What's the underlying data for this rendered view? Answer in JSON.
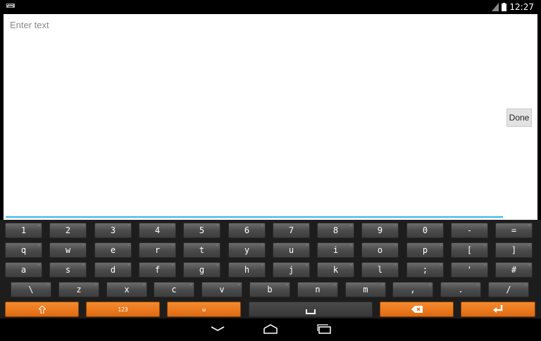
{
  "status_bar": {
    "time": "12:27"
  },
  "editor": {
    "placeholder": "Enter text",
    "done_label": "Done"
  },
  "keyboard": {
    "rows": [
      [
        "1",
        "2",
        "3",
        "4",
        "5",
        "6",
        "7",
        "8",
        "9",
        "0",
        "-",
        "="
      ],
      [
        "q",
        "w",
        "e",
        "r",
        "t",
        "y",
        "u",
        "i",
        "o",
        "p",
        "[",
        "]"
      ],
      [
        "a",
        "s",
        "d",
        "f",
        "g",
        "h",
        "j",
        "k",
        "l",
        ";",
        "'",
        "#"
      ],
      [
        "\\",
        "z",
        "x",
        "c",
        "v",
        "b",
        "n",
        "m",
        ",",
        ".",
        "/"
      ]
    ],
    "function_row": {
      "numbers_label": "123",
      "layout_label": "ω"
    }
  },
  "icons": {
    "notification": "keyboard-notification-icon",
    "signal": "signal-icon",
    "battery": "battery-icon",
    "shift": "shift-icon",
    "space": "space-icon",
    "backspace": "backspace-icon",
    "enter": "enter-icon",
    "back": "back-icon",
    "home": "home-icon",
    "recents": "recents-icon"
  },
  "colors": {
    "accent": "#33b5e5",
    "orange_key": "#e87a20",
    "key": "#555555"
  }
}
